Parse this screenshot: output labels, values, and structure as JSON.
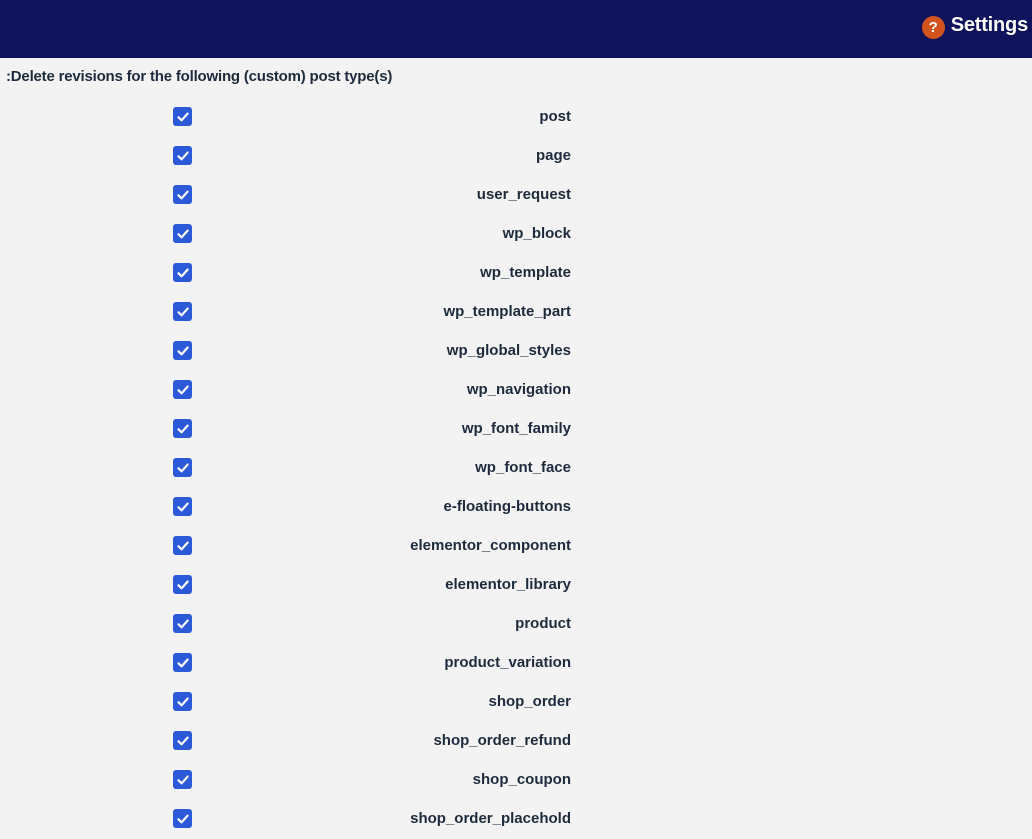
{
  "header": {
    "settings_label": "Settings",
    "help_icon_glyph": "?",
    "background_color": "#0f135b",
    "help_icon_color": "#d3531f"
  },
  "section": {
    "label": ":Delete revisions for the following (custom) post type(s)"
  },
  "post_types": [
    {
      "label": "post",
      "checked": true
    },
    {
      "label": "page",
      "checked": true
    },
    {
      "label": "user_request",
      "checked": true
    },
    {
      "label": "wp_block",
      "checked": true
    },
    {
      "label": "wp_template",
      "checked": true
    },
    {
      "label": "wp_template_part",
      "checked": true
    },
    {
      "label": "wp_global_styles",
      "checked": true
    },
    {
      "label": "wp_navigation",
      "checked": true
    },
    {
      "label": "wp_font_family",
      "checked": true
    },
    {
      "label": "wp_font_face",
      "checked": true
    },
    {
      "label": "e-floating-buttons",
      "checked": true
    },
    {
      "label": "elementor_component",
      "checked": true
    },
    {
      "label": "elementor_library",
      "checked": true
    },
    {
      "label": "product",
      "checked": true
    },
    {
      "label": "product_variation",
      "checked": true
    },
    {
      "label": "shop_order",
      "checked": true
    },
    {
      "label": "shop_order_refund",
      "checked": true
    },
    {
      "label": "shop_coupon",
      "checked": true
    },
    {
      "label": "shop_order_placehold",
      "checked": true
    }
  ],
  "colors": {
    "checkbox": "#2b59d8",
    "text": "#1e2b3d",
    "page_background": "#f3f3f3"
  }
}
